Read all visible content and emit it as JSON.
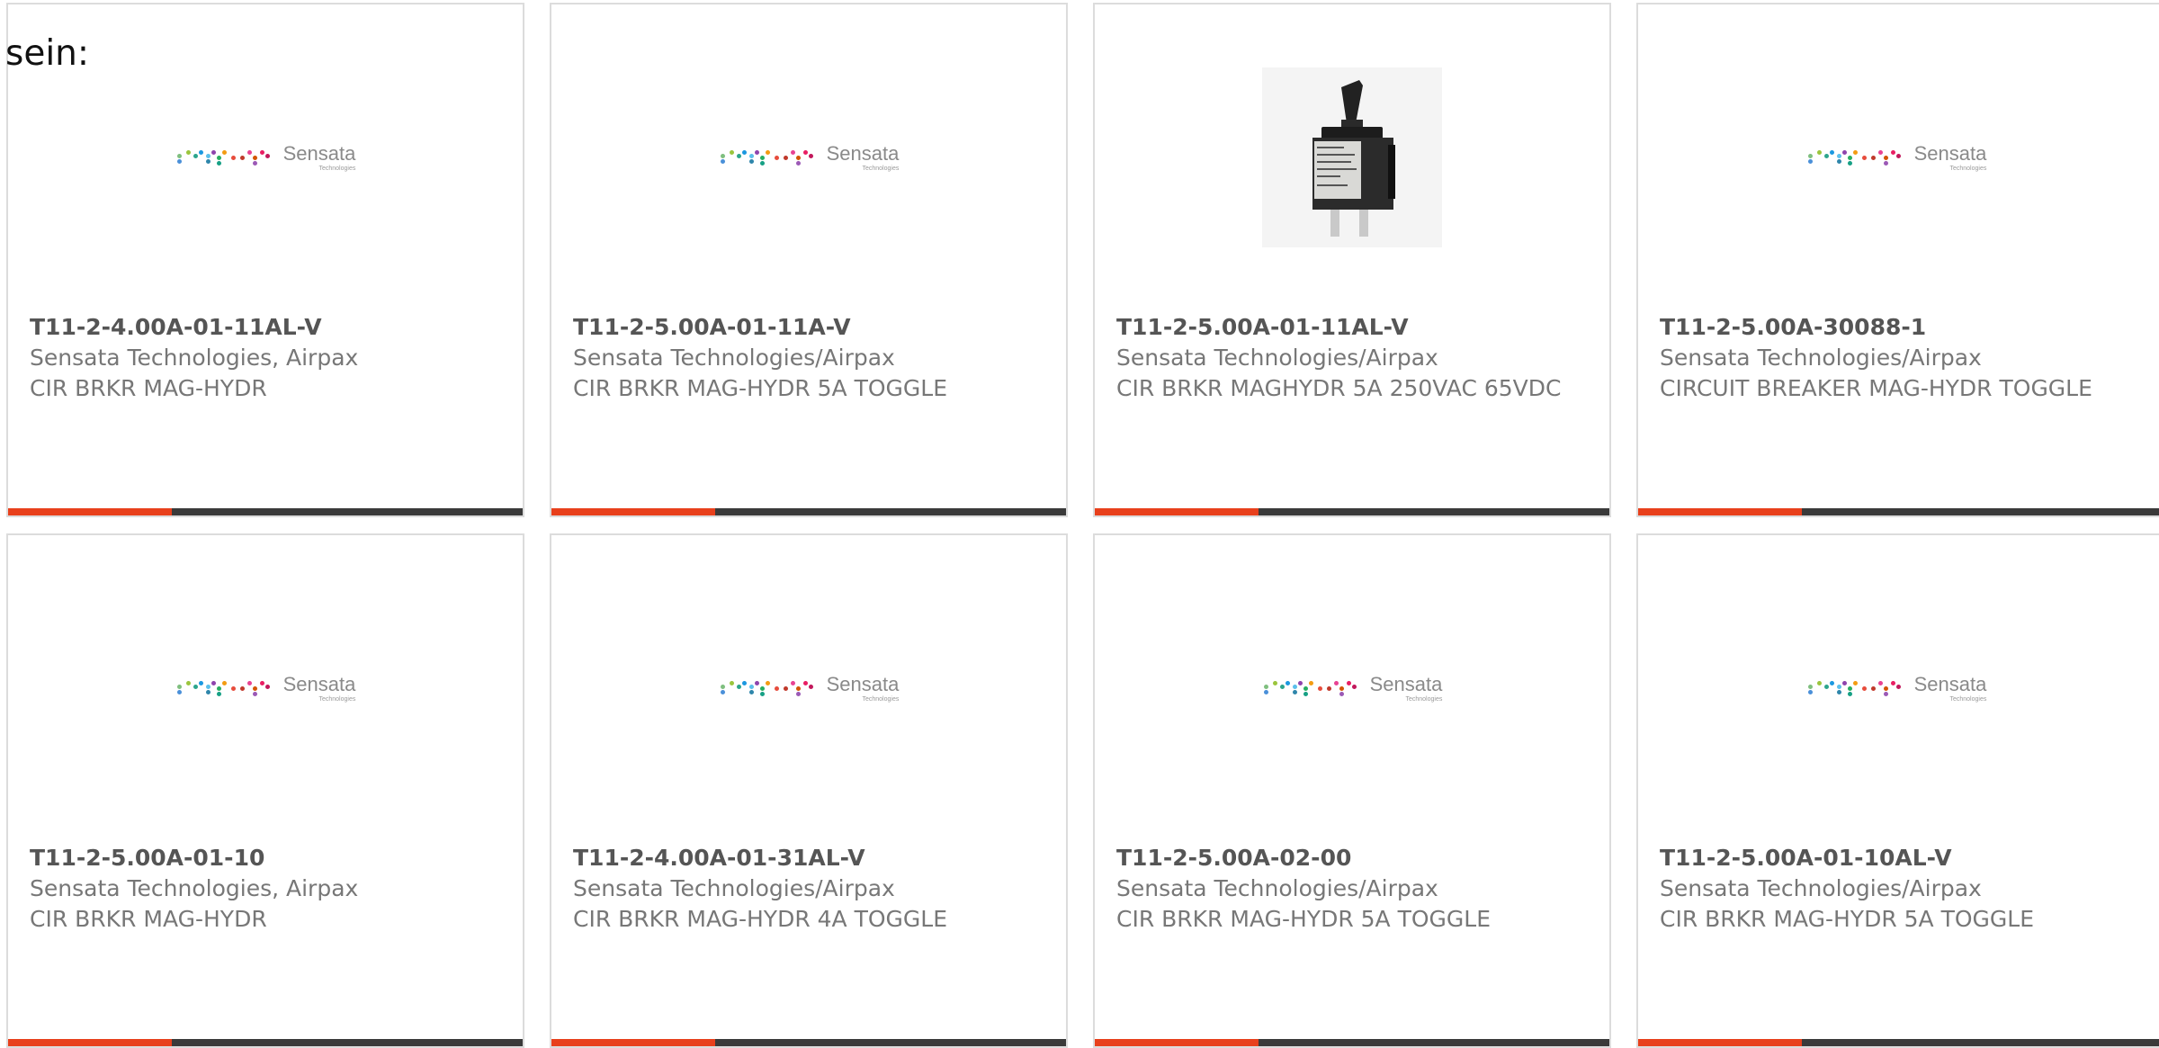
{
  "intro_text": "sein:",
  "colors": {
    "accent": "#e8401c",
    "bar": "#3a3a3a"
  },
  "products": [
    {
      "part": "T11-2-4.00A-01-11AL-V",
      "manufacturer": "Sensata Technologies, Airpax",
      "description": "CIR BRKR MAG-HYDR",
      "image": "sensata-logo"
    },
    {
      "part": "T11-2-5.00A-01-11A-V",
      "manufacturer": "Sensata Technologies/Airpax",
      "description": "CIR BRKR MAG-HYDR 5A TOGGLE",
      "image": "sensata-logo"
    },
    {
      "part": "T11-2-5.00A-01-11AL-V",
      "manufacturer": "Sensata Technologies/Airpax",
      "description": "CIR BRKR MAGHYDR 5A 250VAC 65VDC",
      "image": "breaker-photo"
    },
    {
      "part": "T11-2-5.00A-30088-1",
      "manufacturer": "Sensata Technologies/Airpax",
      "description": "CIRCUIT BREAKER MAG-HYDR TOGGLE",
      "image": "sensata-logo"
    },
    {
      "part": "T11-2-5.00A-01-10",
      "manufacturer": "Sensata Technologies, Airpax",
      "description": "CIR BRKR MAG-HYDR",
      "image": "sensata-logo"
    },
    {
      "part": "T11-2-4.00A-01-31AL-V",
      "manufacturer": "Sensata Technologies/Airpax",
      "description": "CIR BRKR MAG-HYDR 4A TOGGLE",
      "image": "sensata-logo"
    },
    {
      "part": "T11-2-5.00A-02-00",
      "manufacturer": "Sensata Technologies/Airpax",
      "description": "CIR BRKR MAG-HYDR 5A TOGGLE",
      "image": "sensata-logo"
    },
    {
      "part": "T11-2-5.00A-01-10AL-V",
      "manufacturer": "Sensata Technologies/Airpax",
      "description": "CIR BRKR MAG-HYDR 5A TOGGLE",
      "image": "sensata-logo"
    }
  ],
  "logo": {
    "word": "Sensata",
    "sub": "Technologies"
  }
}
